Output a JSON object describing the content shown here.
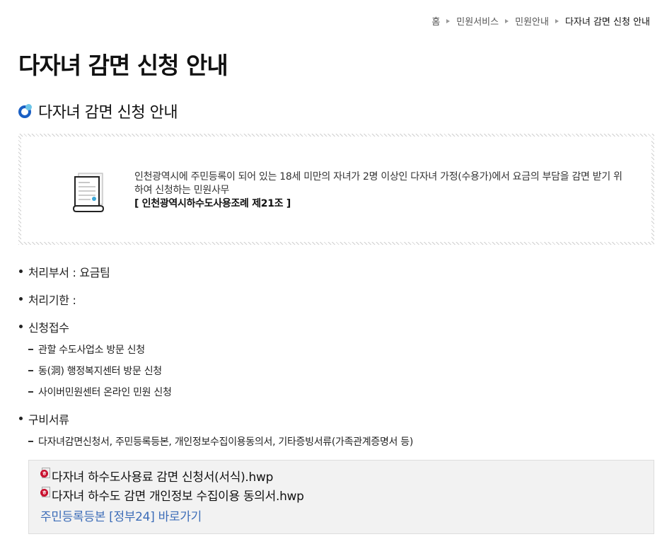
{
  "breadcrumb": {
    "items": [
      "홈",
      "민원서비스",
      "민원안내",
      "다자녀 감면 신청 안내"
    ]
  },
  "page_title": "다자녀 감면 신청 안내",
  "section_title": "다자녀 감면 신청 안내",
  "info": {
    "description": "인천광역시에 주민등록이 되어 있는 18세 미만의 자녀가 2명 이상인 다자녀 가정(수용가)에서 요금의 부담을 감면 받기 위하여 신청하는 민원사무",
    "law": "[ 인천광역시하수도사용조례 제21조 ]"
  },
  "details": {
    "department": "처리부서 : 요금팀",
    "deadline": "처리기한 :",
    "application": {
      "title": "신청접수",
      "methods": [
        "관할 수도사업소 방문 신청",
        "동(洞) 행정복지센터 방문 신청",
        "사이버민원센터 온라인 민원 신청"
      ]
    },
    "documents": {
      "title": "구비서류",
      "list": [
        "다자녀감면신청서, 주민등록등본, 개인정보수집이용동의서, 기타증빙서류(가족관계증명서 등)"
      ]
    }
  },
  "downloads": {
    "files": [
      "다자녀 하수도사용료 감면 신청서(서식).hwp",
      "다자녀 하수도 감면 개인정보 수집이용 동의서.hwp"
    ],
    "gov24_link": "주민등록등본 [정부24] 바로가기",
    "file_icon_letter": "ㅎ"
  },
  "colors": {
    "link": "#3d6db8",
    "icon_ring": "#1a5fc4",
    "icon_dot": "#6cc5e8",
    "hwp_badge": "#c8102e"
  }
}
